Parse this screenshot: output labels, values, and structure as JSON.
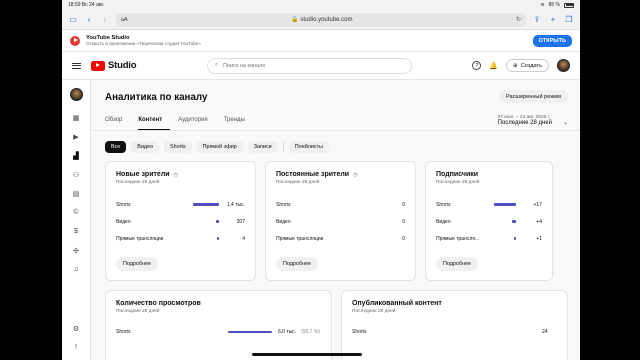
{
  "status": {
    "time": "18:59",
    "date": "Вс 24 авг.",
    "battery": "85 %"
  },
  "browser": {
    "aa": "aA",
    "url": "studio.youtube.com"
  },
  "banner": {
    "title": "YouTube Studio",
    "subtitle": "Открыть в приложении «Творческая студия YouTube»",
    "open": "ОТКРЫТЬ"
  },
  "header": {
    "logo": "Studio",
    "search_placeholder": "Поиск на канале",
    "create": "Создать"
  },
  "page": {
    "title": "Аналитика по каналу",
    "advanced": "Расширенный режим",
    "tabs": [
      "Обзор",
      "Контент",
      "Аудитория",
      "Тренды"
    ],
    "period_range": "27 июл. – 23 авг. 2025 г.",
    "period_label": "Последние 28 дней"
  },
  "chips": [
    "Все",
    "Видео",
    "Shorts",
    "Прямой эфир",
    "Записи",
    "Плейлисты"
  ],
  "cards": [
    {
      "title": "Новые зрители",
      "subtitle": "Последние 28 дней",
      "rows": [
        {
          "label": "Shorts",
          "value": "1,4 тыс.",
          "fill": 1.0
        },
        {
          "label": "Видео",
          "value": "207",
          "fill": 0.12
        },
        {
          "label": "Прямые трансляции",
          "value": "4",
          "fill": 0.03
        }
      ],
      "more": "Подробнее"
    },
    {
      "title": "Постоянные зрители",
      "subtitle": "Последние 28 дней",
      "rows": [
        {
          "label": "Shorts",
          "value": "0"
        },
        {
          "label": "Видео",
          "value": "0"
        },
        {
          "label": "Прямые трансляции",
          "value": "0"
        }
      ],
      "more": "Подробнее"
    },
    {
      "title": "Подписчики",
      "subtitle": "Последние 28 дней",
      "rows": [
        {
          "label": "Shorts",
          "value": "+17",
          "fill": 1.0
        },
        {
          "label": "Видео",
          "value": "+4",
          "fill": 0.2
        },
        {
          "label": "Прямые трансля...",
          "value": "+1",
          "fill": 0.08
        }
      ],
      "more": "Подробнее"
    }
  ],
  "bottom_cards": [
    {
      "title": "Количество просмотров",
      "subtitle": "Последние 28 дней",
      "row_label": "Shorts",
      "row_value": "6,0 тыс.",
      "row_pct": "(95,7 %)"
    },
    {
      "title": "Опубликованный контент",
      "subtitle": "Последние 28 дней",
      "row_label": "Shorts",
      "row_value": "24"
    }
  ],
  "colors": {
    "accent": "#4f4fc2",
    "open_button": "#1a73e8",
    "yt_red": "#ff0000"
  }
}
